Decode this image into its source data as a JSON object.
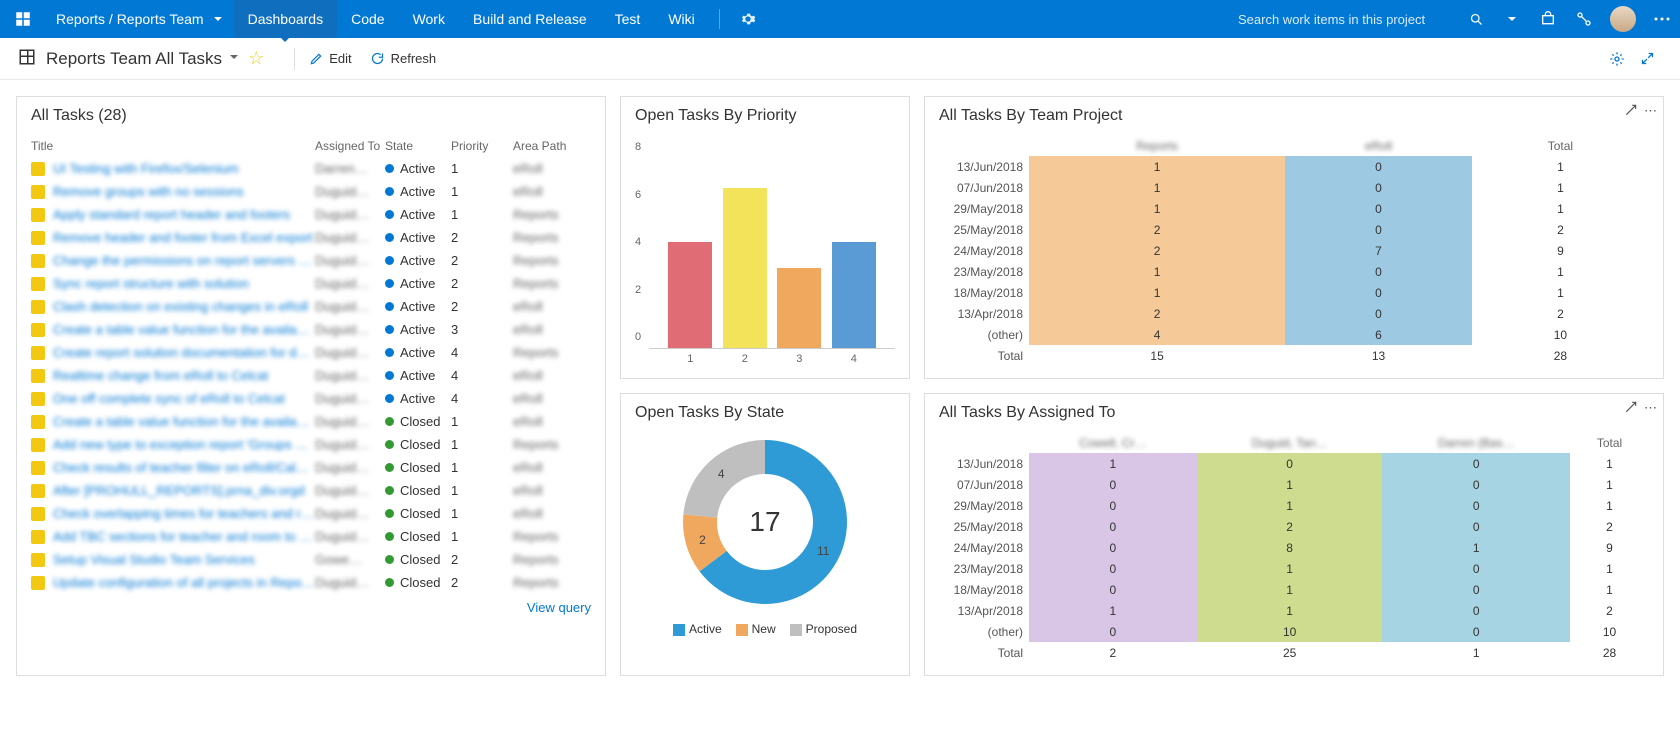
{
  "topnav": {
    "breadcrumb": "Reports / Reports Team",
    "items": [
      "Dashboards",
      "Code",
      "Work",
      "Build and Release",
      "Test",
      "Wiki"
    ],
    "active_index": 0,
    "search_placeholder": "Search work items in this project"
  },
  "subhead": {
    "title": "Reports Team All Tasks",
    "edit": "Edit",
    "refresh": "Refresh"
  },
  "alltasks": {
    "title": "All Tasks (28)",
    "columns": {
      "title": "Title",
      "assigned": "Assigned To",
      "state": "State",
      "priority": "Priority",
      "area": "Area Path"
    },
    "view_query": "View query",
    "rows": [
      {
        "title": "UI Testing with Firefox/Selenium",
        "assigned": "Darren…",
        "state": "Active",
        "priority": "1",
        "area": "eRoll"
      },
      {
        "title": "Remove groups with no sessions",
        "assigned": "Duguid…",
        "state": "Active",
        "priority": "1",
        "area": "eRoll"
      },
      {
        "title": "Apply standard report header and footers",
        "assigned": "Duguid…",
        "state": "Active",
        "priority": "1",
        "area": "Reports"
      },
      {
        "title": "Remove header and footer from Excel export",
        "assigned": "Duguid…",
        "state": "Active",
        "priority": "2",
        "area": "Reports"
      },
      {
        "title": "Change the permissions on report servers for ad…",
        "assigned": "Duguid…",
        "state": "Active",
        "priority": "2",
        "area": "Reports"
      },
      {
        "title": "Sync report structure with solution",
        "assigned": "Duguid…",
        "state": "Active",
        "priority": "2",
        "area": "Reports"
      },
      {
        "title": "Clash detection on existing changes in eRoll",
        "assigned": "Duguid…",
        "state": "Active",
        "priority": "2",
        "area": "eRoll"
      },
      {
        "title": "Create a table value function for the available ro…",
        "assigned": "Duguid…",
        "state": "Active",
        "priority": "3",
        "area": "eRoll"
      },
      {
        "title": "Create report solution documentation for develo…",
        "assigned": "Duguid…",
        "state": "Active",
        "priority": "4",
        "area": "Reports"
      },
      {
        "title": "Realtime change from eRoll to Celcat",
        "assigned": "Duguid…",
        "state": "Active",
        "priority": "4",
        "area": "eRoll"
      },
      {
        "title": "One off complete sync of eRoll to Celcat",
        "assigned": "Duguid…",
        "state": "Active",
        "priority": "4",
        "area": "eRoll"
      },
      {
        "title": "Create a table value function for the available ti…",
        "assigned": "Duguid…",
        "state": "Closed",
        "priority": "1",
        "area": "eRoll"
      },
      {
        "title": "Add new type to exception report 'Groups With…",
        "assigned": "Duguid…",
        "state": "Closed",
        "priority": "1",
        "area": "Reports"
      },
      {
        "title": "Check results of teacher filter on eRoll/Calenda…",
        "assigned": "Duguid…",
        "state": "Closed",
        "priority": "1",
        "area": "eRoll"
      },
      {
        "title": "After [PROHULL_REPORTS].prna_div.orgd",
        "assigned": "Duguid…",
        "state": "Closed",
        "priority": "1",
        "area": "eRoll"
      },
      {
        "title": "Check overlapping times for teachers and rooms",
        "assigned": "Duguid…",
        "state": "Closed",
        "priority": "1",
        "area": "eRoll"
      },
      {
        "title": "Add TBC sections for teacher and room to excep…",
        "assigned": "Duguid…",
        "state": "Closed",
        "priority": "1",
        "area": "Reports"
      },
      {
        "title": "Setup Visual Studio Team Services",
        "assigned": "Gowe…",
        "state": "Closed",
        "priority": "2",
        "area": "Reports"
      },
      {
        "title": "Update configuration of all projects in Reports d…",
        "assigned": "Duguid…",
        "state": "Closed",
        "priority": "2",
        "area": "Reports"
      }
    ]
  },
  "chart_data": [
    {
      "id": "priority",
      "title": "Open Tasks By Priority",
      "type": "bar",
      "categories": [
        "1",
        "2",
        "3",
        "4"
      ],
      "values": [
        4,
        6,
        3,
        4
      ],
      "colors": [
        "#e06c75",
        "#f2e35b",
        "#f0a85e",
        "#5b9bd5"
      ],
      "ylim": [
        0,
        8
      ],
      "yticks": [
        0,
        2,
        4,
        6,
        8
      ]
    },
    {
      "id": "state",
      "title": "Open Tasks By State",
      "type": "pie",
      "center_total": "17",
      "slices": [
        {
          "name": "Active",
          "value": 11,
          "color": "#2e9bd6"
        },
        {
          "name": "New",
          "value": 2,
          "color": "#f0a85e"
        },
        {
          "name": "Proposed",
          "value": 4,
          "color": "#bfbfbf"
        }
      ]
    },
    {
      "id": "teamproject",
      "title": "All Tasks By Team Project",
      "type": "table",
      "col_headers": [
        "Reports",
        "eRoll",
        "Total"
      ],
      "col_colors": [
        "c-orange",
        "c-blue",
        ""
      ],
      "rows": [
        {
          "label": "13/Jun/2018",
          "cells": [
            "1",
            "0",
            "1"
          ]
        },
        {
          "label": "07/Jun/2018",
          "cells": [
            "1",
            "0",
            "1"
          ]
        },
        {
          "label": "29/May/2018",
          "cells": [
            "1",
            "0",
            "1"
          ]
        },
        {
          "label": "25/May/2018",
          "cells": [
            "2",
            "0",
            "2"
          ]
        },
        {
          "label": "24/May/2018",
          "cells": [
            "2",
            "7",
            "9"
          ]
        },
        {
          "label": "23/May/2018",
          "cells": [
            "1",
            "0",
            "1"
          ]
        },
        {
          "label": "18/May/2018",
          "cells": [
            "1",
            "0",
            "1"
          ]
        },
        {
          "label": "13/Apr/2018",
          "cells": [
            "2",
            "0",
            "2"
          ]
        },
        {
          "label": "(other)",
          "cells": [
            "4",
            "6",
            "10"
          ]
        },
        {
          "label": "Total",
          "cells": [
            "15",
            "13",
            "28"
          ]
        }
      ]
    },
    {
      "id": "assigned",
      "title": "All Tasks By Assigned To",
      "type": "table",
      "col_headers": [
        "Cowell, Cr…",
        "Duguid, Tan…",
        "Darren (Bas…",
        "Total"
      ],
      "col_colors": [
        "c-purple",
        "c-green",
        "c-teal",
        ""
      ],
      "rows": [
        {
          "label": "13/Jun/2018",
          "cells": [
            "1",
            "0",
            "0",
            "1"
          ]
        },
        {
          "label": "07/Jun/2018",
          "cells": [
            "0",
            "1",
            "0",
            "1"
          ]
        },
        {
          "label": "29/May/2018",
          "cells": [
            "0",
            "1",
            "0",
            "1"
          ]
        },
        {
          "label": "25/May/2018",
          "cells": [
            "0",
            "2",
            "0",
            "2"
          ]
        },
        {
          "label": "24/May/2018",
          "cells": [
            "0",
            "8",
            "1",
            "9"
          ]
        },
        {
          "label": "23/May/2018",
          "cells": [
            "0",
            "1",
            "0",
            "1"
          ]
        },
        {
          "label": "18/May/2018",
          "cells": [
            "0",
            "1",
            "0",
            "1"
          ]
        },
        {
          "label": "13/Apr/2018",
          "cells": [
            "1",
            "1",
            "0",
            "2"
          ]
        },
        {
          "label": "(other)",
          "cells": [
            "0",
            "10",
            "0",
            "10"
          ]
        },
        {
          "label": "Total",
          "cells": [
            "2",
            "25",
            "1",
            "28"
          ]
        }
      ]
    }
  ]
}
